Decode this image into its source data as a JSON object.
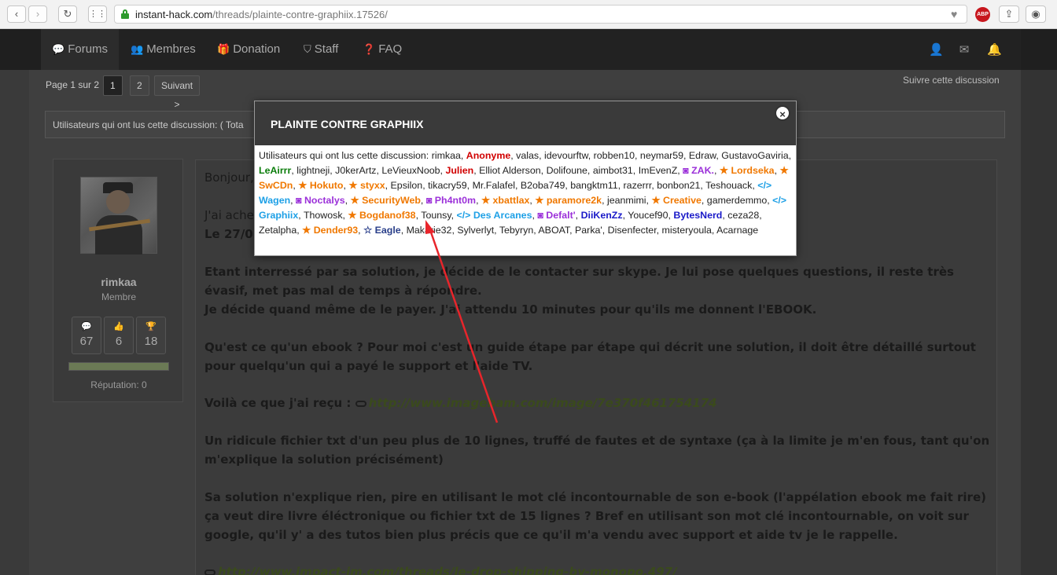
{
  "browser": {
    "url_host": "instant-hack.com",
    "url_path": "/threads/plainte-contre-graphiix.17526/",
    "back_icon": "chevron-left",
    "forward_icon": "chevron-right",
    "reload_icon": "reload",
    "apps_icon": "grid",
    "abp_label": "ABP"
  },
  "nav": {
    "items": [
      {
        "label": "Forums",
        "icon": "comments-icon"
      },
      {
        "label": "Membres",
        "icon": "users-icon"
      },
      {
        "label": "Donation",
        "icon": "gift-icon"
      },
      {
        "label": "Staff",
        "icon": "shield-icon"
      },
      {
        "label": "FAQ",
        "icon": "question-icon"
      }
    ]
  },
  "pager": {
    "text": "Page 1 sur 2",
    "pages": [
      "1",
      "2"
    ],
    "next": "Suivant >"
  },
  "follow": "Suivre cette discussion",
  "readers_bar": "Utilisateurs qui ont lus cette discussion: ( Tota",
  "user": {
    "name": "rimkaa",
    "role": "Membre",
    "stats": [
      "67",
      "6",
      "18"
    ],
    "reputation": "Réputation: 0"
  },
  "post": {
    "lines": [
      "Bonjour,",
      "J'ai ache",
      "Le 27/0",
      "Etant interressé par sa solution, je décide de le contacter sur skype. Je lui pose quelques questions, il reste très",
      "évasif, met pas mal de temps à répondre.",
      "Je décide quand même de le payer. J'ai attendu 10 minutes pour qu'ils me donnent l'EBOOK.",
      "Qu'est ce qu'un ebook ? Pour moi c'est un guide étape par étape qui décrit une solution, il doit être détaillé surtout",
      "pour quelqu'un qui a payé le support et l'aide TV.",
      "Voilà ce que j'ai reçu : ",
      "http://www.imagebam.com/image/7e370f461754174",
      "Un ridicule fichier txt d'un peu plus de 10 lignes, truffé de fautes et de syntaxe (ça à la limite je m'en fous, tant qu'on",
      "m'explique la solution précisément)",
      "Sa solution n'explique rien, pire en utilisant le mot clé incontournable de son e-book (l'appélation ebook me fait rire)",
      "ça veut dire livre éléctronique ou fichier txt de 15 lignes ? Bref en utilisant son mot clé incontournable, on voit sur",
      "google, qu'il y' a des tutos bien plus précis que ce qu'il m'a vendu avec support et aide tv je le rappelle.",
      "http://www.impact-im.com/threads/le-drop-shipping-by-monopo.497/"
    ]
  },
  "modal": {
    "title": "PLAINTE CONTRE GRAPHIIX",
    "close": "×",
    "intro": "Utilisateurs qui ont lus cette discussion: ",
    "users": [
      {
        "n": "rimkaa",
        "s": ""
      },
      {
        "n": "Anonyme",
        "s": "red"
      },
      {
        "n": "valas",
        "s": ""
      },
      {
        "n": "idevourftw",
        "s": ""
      },
      {
        "n": "robben10",
        "s": ""
      },
      {
        "n": "neymar59",
        "s": ""
      },
      {
        "n": "Edraw",
        "s": ""
      },
      {
        "n": "GustavoGaviria",
        "s": ""
      },
      {
        "n": "LeAirrr",
        "s": "green"
      },
      {
        "n": "lightneji",
        "s": ""
      },
      {
        "n": "J0kerArtz",
        "s": ""
      },
      {
        "n": "LeVieuxNoob",
        "s": ""
      },
      {
        "n": "Julien",
        "s": "red"
      },
      {
        "n": "Elliot Alderson",
        "s": ""
      },
      {
        "n": "Dolifoune",
        "s": ""
      },
      {
        "n": "aimbot31",
        "s": ""
      },
      {
        "n": "ImEvenZ",
        "s": ""
      },
      {
        "n": "ZAK.",
        "s": "purple-eye"
      },
      {
        "n": "Lordseka",
        "s": "orange-star"
      },
      {
        "n": "SwCDn",
        "s": "orange-star"
      },
      {
        "n": "Hokuto",
        "s": "orange-star"
      },
      {
        "n": "styxx",
        "s": "orange-star"
      },
      {
        "n": "Epsilon",
        "s": ""
      },
      {
        "n": "tikacry59",
        "s": ""
      },
      {
        "n": "Mr.Falafel",
        "s": ""
      },
      {
        "n": "B2oba749",
        "s": ""
      },
      {
        "n": "bangktm11",
        "s": ""
      },
      {
        "n": "razerrr",
        "s": ""
      },
      {
        "n": "bonbon21",
        "s": ""
      },
      {
        "n": "Teshouack",
        "s": ""
      },
      {
        "n": "Wagen",
        "s": "cyan-code"
      },
      {
        "n": "Noctalys",
        "s": "purple-eye"
      },
      {
        "n": "SecurityWeb",
        "s": "orange-star"
      },
      {
        "n": "Ph4nt0m",
        "s": "purple-eye"
      },
      {
        "n": "xbattlax",
        "s": "orange-star"
      },
      {
        "n": "paramore2k",
        "s": "orange-star"
      },
      {
        "n": "jeanmimi",
        "s": ""
      },
      {
        "n": "Creative",
        "s": "orange-star"
      },
      {
        "n": "gamerdemmo",
        "s": ""
      },
      {
        "n": "Graphiix",
        "s": "cyan-code"
      },
      {
        "n": "Thowosk",
        "s": ""
      },
      {
        "n": "Bogdanof38",
        "s": "orange-star"
      },
      {
        "n": "Tounsy",
        "s": ""
      },
      {
        "n": "Des Arcanes",
        "s": "cyan-code"
      },
      {
        "n": "Defalt'",
        "s": "purple-eye"
      },
      {
        "n": "DiiKenZz",
        "s": "blue"
      },
      {
        "n": "Youcef90",
        "s": ""
      },
      {
        "n": "BytesNerd",
        "s": "blue"
      },
      {
        "n": "ceza28",
        "s": ""
      },
      {
        "n": "Zetalpha",
        "s": ""
      },
      {
        "n": "Dender93",
        "s": "orange-star"
      },
      {
        "n": "Eagle",
        "s": "navy-star"
      },
      {
        "n": "Makarie32",
        "s": ""
      },
      {
        "n": "Sylverlyt",
        "s": ""
      },
      {
        "n": "Tebyryn",
        "s": ""
      },
      {
        "n": "ABOAT",
        "s": ""
      },
      {
        "n": "Parka'",
        "s": ""
      },
      {
        "n": "Disenfecter",
        "s": ""
      },
      {
        "n": "misteryoula",
        "s": ""
      },
      {
        "n": "Acarnage",
        "s": ""
      }
    ]
  },
  "colors": {
    "annotation_arrow": "#e8252b",
    "green_bar": "#6b7a55"
  }
}
